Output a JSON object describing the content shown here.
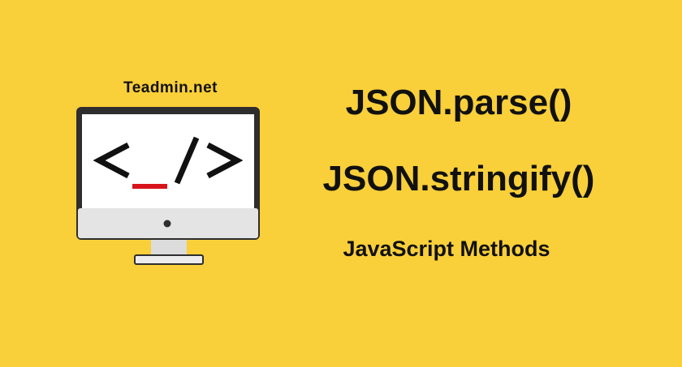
{
  "background_color": "#f9cf3a",
  "brand": {
    "text": "Teadmin.net"
  },
  "illustration": {
    "icon": "monitor-code-icon",
    "code_text": "<_/>",
    "accent_color": "#d8141b"
  },
  "headlines": {
    "line1": "JSON.parse()",
    "line2": "JSON.stringify()"
  },
  "subtitle": {
    "text": "JavaScript Methods"
  }
}
